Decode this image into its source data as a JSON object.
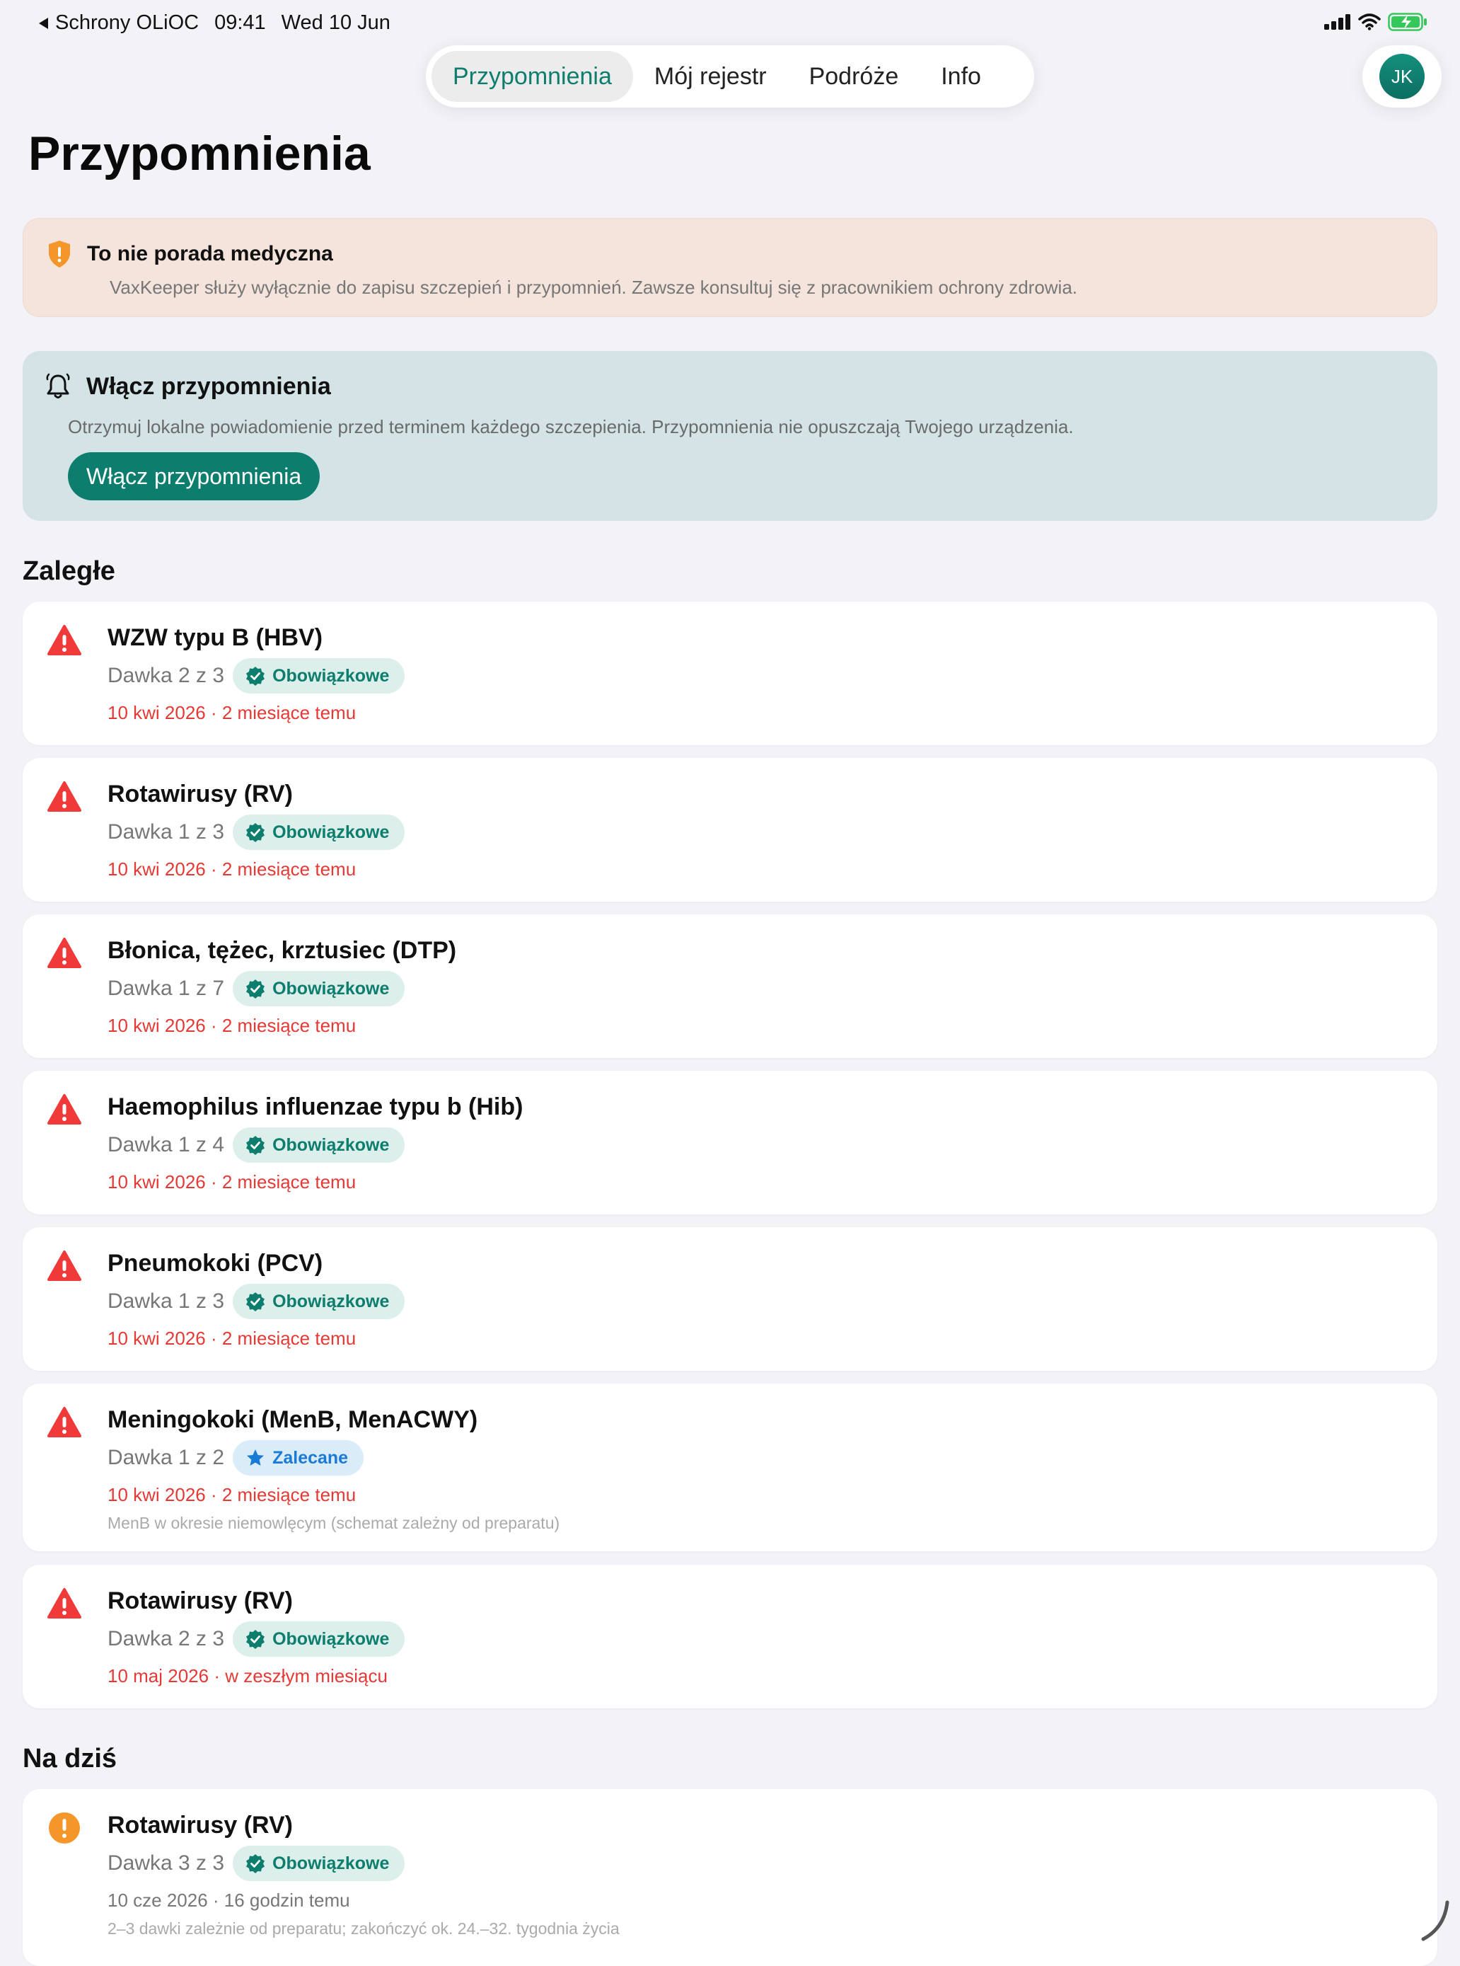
{
  "status": {
    "back_label": "Schrony OLiOC",
    "time": "09:41",
    "date": "Wed 10 Jun"
  },
  "tabs": [
    {
      "label": "Przypomnienia",
      "active": true
    },
    {
      "label": "Mój rejestr",
      "active": false
    },
    {
      "label": "Podróże",
      "active": false
    },
    {
      "label": "Info",
      "active": false
    }
  ],
  "avatar_initials": "JK",
  "page_title": "Przypomnienia",
  "disclaimer": {
    "title": "To nie porada medyczna",
    "body": "VaxKeeper służy wyłącznie do zapisu szczepień i przypomnień. Zawsze konsultuj się z pracownikiem ochrony zdrowia.",
    "icon": "shield-exclamation-icon"
  },
  "notifications": {
    "title": "Włącz przypomnienia",
    "body": "Otrzymuj lokalne powiadomienie przed terminem każdego szczepienia. Przypomnienia nie opuszczają Twojego urządzenia.",
    "button_label": "Włącz przypomnienia",
    "icon": "bell-icon"
  },
  "sections": {
    "overdue_title": "Zaległe",
    "today_title": "Na dziś"
  },
  "overdue": [
    {
      "name": "WZW typu B (HBV)",
      "dose": "Dawka 2 z 3",
      "badge": "Obowiązkowe",
      "badge_type": "mandatory",
      "date": "10 kwi 2026 · 2 miesiące temu",
      "note": ""
    },
    {
      "name": "Rotawirusy (RV)",
      "dose": "Dawka 1 z 3",
      "badge": "Obowiązkowe",
      "badge_type": "mandatory",
      "date": "10 kwi 2026 · 2 miesiące temu",
      "note": ""
    },
    {
      "name": "Błonica, tężec, krztusiec (DTP)",
      "dose": "Dawka 1 z 7",
      "badge": "Obowiązkowe",
      "badge_type": "mandatory",
      "date": "10 kwi 2026 · 2 miesiące temu",
      "note": ""
    },
    {
      "name": "Haemophilus influenzae typu b (Hib)",
      "dose": "Dawka 1 z 4",
      "badge": "Obowiązkowe",
      "badge_type": "mandatory",
      "date": "10 kwi 2026 · 2 miesiące temu",
      "note": ""
    },
    {
      "name": "Pneumokoki (PCV)",
      "dose": "Dawka 1 z 3",
      "badge": "Obowiązkowe",
      "badge_type": "mandatory",
      "date": "10 kwi 2026 · 2 miesiące temu",
      "note": ""
    },
    {
      "name": "Meningokoki (MenB, MenACWY)",
      "dose": "Dawka 1 z 2",
      "badge": "Zalecane",
      "badge_type": "recommended",
      "date": "10 kwi 2026 · 2 miesiące temu",
      "note": "MenB w okresie niemowlęcym (schemat zależny od preparatu)"
    },
    {
      "name": "Rotawirusy (RV)",
      "dose": "Dawka 2 z 3",
      "badge": "Obowiązkowe",
      "badge_type": "mandatory",
      "date": "10 maj 2026 · w zeszłym miesiącu",
      "note": ""
    }
  ],
  "today": [
    {
      "name": "Rotawirusy (RV)",
      "dose": "Dawka 3 z 3",
      "badge": "Obowiązkowe",
      "badge_type": "mandatory",
      "date": "10 cze 2026 · 16 godzin temu",
      "note": "2–3 dawki zależnie od preparatu; zakończyć ok. 24.–32. tygodnia życia"
    }
  ],
  "colors": {
    "accent": "#0d7d6e",
    "overdue": "#e53935",
    "today": "#f5962a",
    "recommended": "#1a7bd6"
  }
}
